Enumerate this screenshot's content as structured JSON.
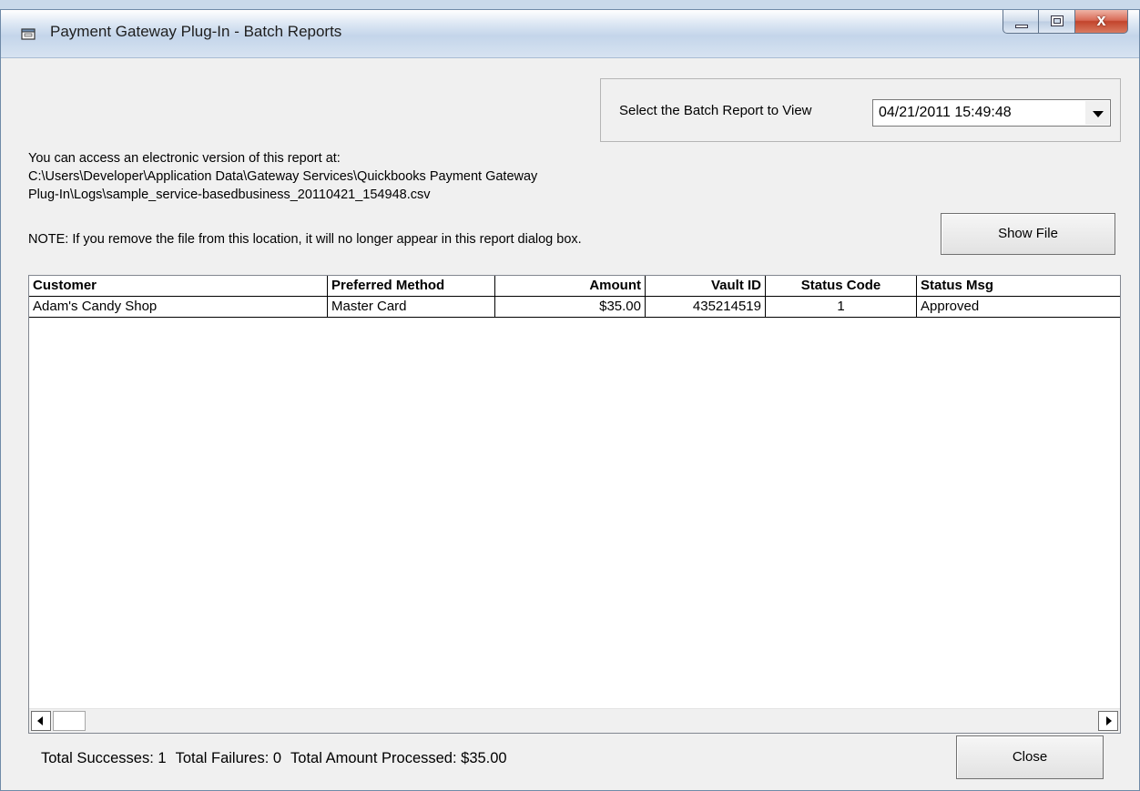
{
  "window": {
    "title": "Payment Gateway Plug-In - Batch Reports",
    "close_glyph": "x"
  },
  "batch_select": {
    "label": "Select the Batch Report to View",
    "value": "04/21/2011 15:49:48"
  },
  "info": {
    "line1": "You can access an electronic version of this report at:",
    "line2": "C:\\Users\\Developer\\Application Data\\Gateway Services\\Quickbooks Payment Gateway",
    "line3": "Plug-In\\Logs\\sample_service-basedbusiness_20110421_154948.csv",
    "note": "NOTE:  If you remove the file from this location, it will no longer appear in this report dialog box."
  },
  "buttons": {
    "show_file": "Show File",
    "close": "Close"
  },
  "grid": {
    "columns": [
      "Customer",
      "Preferred Method",
      "Amount",
      "Vault ID",
      "Status Code",
      "Status Msg"
    ],
    "rows": [
      [
        "Adam's Candy Shop",
        "Master Card",
        "$35.00",
        "435214519",
        "1",
        "Approved"
      ]
    ]
  },
  "totals": {
    "successes": "Total Successes: 1",
    "failures": "Total Failures: 0",
    "amount": "Total Amount Processed: $35.00"
  },
  "colors": {
    "window_bg": "#f0f0f0",
    "close_button": "#c2442c"
  }
}
